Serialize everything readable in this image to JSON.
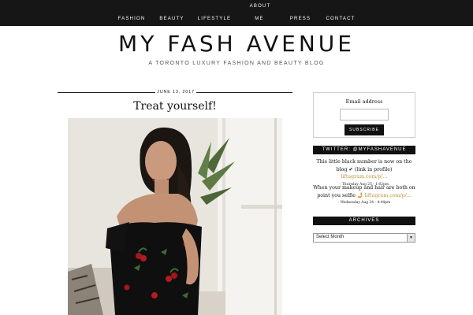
{
  "nav": {
    "about": "ABOUT",
    "items": [
      "FASHION",
      "BEAUTY",
      "LIFESTYLE",
      "ME",
      "PRESS",
      "CONTACT"
    ]
  },
  "header": {
    "title": "MY FASH AVENUE",
    "tagline": "A TORONTO LUXURY FASHION AND BEAUTY BLOG"
  },
  "post": {
    "date": "JUNE 13, 2017",
    "title": "Treat yourself!"
  },
  "subscribe": {
    "label": "Email address",
    "input_value": "",
    "button_label": "SUBSCRIBE"
  },
  "twitter": {
    "header": "TWITTER: @MYFASHAVENUE",
    "tweets": [
      {
        "text": "This little black number is now on the blog ✔ (link in profile) ",
        "link": "liftagram.com/p/...",
        "meta": "- Thursday Aug 25 - 1:02pm"
      },
      {
        "text": "When your makeup and hair are both on point you selfie 🤳 ",
        "link": "liftagram.com/p/...",
        "meta": "- Wednesday Aug 24 - 4:44pm"
      }
    ]
  },
  "archives": {
    "header": "ARCHIVES",
    "selected": "Select Month"
  },
  "colors": {
    "nav_bg": "#161616",
    "accent_gold": "#b8963a",
    "text": "#111111"
  }
}
